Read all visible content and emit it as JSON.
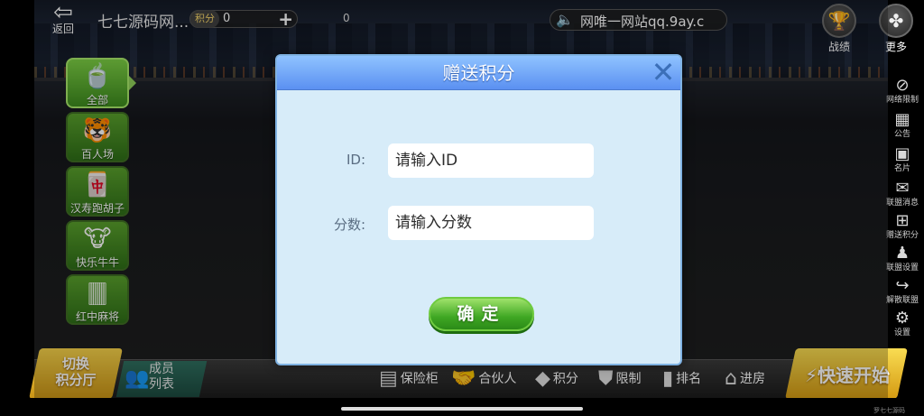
{
  "topbar": {
    "back_label": "返回",
    "club_name": "七七源码网...",
    "score_label": "积分",
    "score_value": "0",
    "extra_value": "0",
    "notice_text": "网唯一网站qq.9ay.c",
    "record_label": "战绩",
    "more_label": "更多"
  },
  "categories": [
    {
      "label": "全部",
      "active": true
    },
    {
      "label": "百人场"
    },
    {
      "label": "汉寿跑胡子"
    },
    {
      "label": "快乐牛牛"
    },
    {
      "label": "红中麻将"
    }
  ],
  "side_menu": [
    {
      "label": "网络限制",
      "icon": "block-icon"
    },
    {
      "label": "公告",
      "icon": "announcement-icon"
    },
    {
      "label": "名片",
      "icon": "card-icon"
    },
    {
      "label": "联盟消息",
      "icon": "mail-icon"
    },
    {
      "label": "赠送积分",
      "icon": "gift-icon"
    },
    {
      "label": "联盟设置",
      "icon": "user-settings-icon"
    },
    {
      "label": "解散联盟",
      "icon": "exit-icon"
    },
    {
      "label": "设置",
      "icon": "gear-icon"
    }
  ],
  "bottom": {
    "switch_line1": "切换",
    "switch_line2": "积分厅",
    "member_line1": "成员",
    "member_line2": "列表",
    "nav": [
      {
        "label": "保险柜",
        "icon": "safe-icon"
      },
      {
        "label": "合伙人",
        "icon": "handshake-icon"
      },
      {
        "label": "积分",
        "icon": "points-icon"
      },
      {
        "label": "限制",
        "icon": "shield-icon"
      },
      {
        "label": "排名",
        "icon": "ranking-icon"
      },
      {
        "label": "进房",
        "icon": "house-icon"
      }
    ],
    "quick_start": "快速开始",
    "watermark": "罗七七源码"
  },
  "dialog": {
    "title": "赠送积分",
    "id_label": "ID:",
    "id_placeholder": "请输入ID",
    "score_label": "分数:",
    "score_placeholder": "请输入分数",
    "confirm_label": "确定"
  }
}
